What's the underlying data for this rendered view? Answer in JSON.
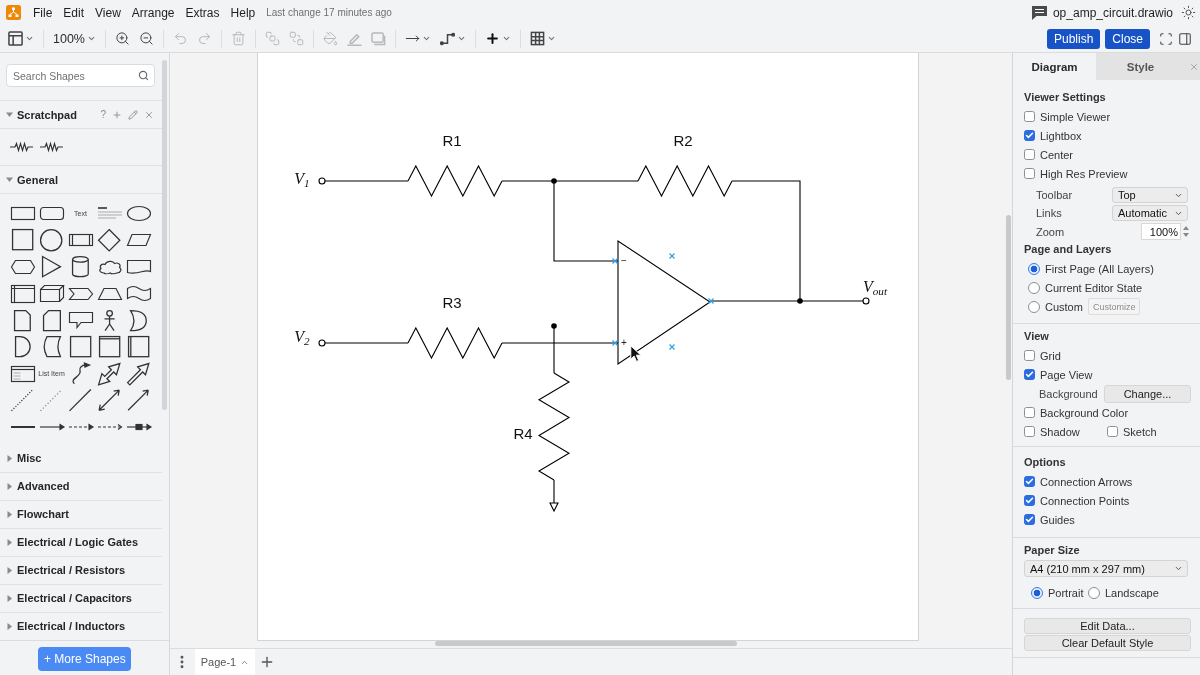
{
  "menubar": {
    "menus": [
      "File",
      "Edit",
      "View",
      "Arrange",
      "Extras",
      "Help"
    ],
    "last_change": "Last change 17 minutes ago",
    "file_name": "op_amp_circuit.drawio"
  },
  "toolbar": {
    "tool_groups": [
      [
        {
          "kind": "format",
          "disabled": false
        }
      ],
      [
        {
          "kind": "zoom",
          "label": "100%",
          "disabled": false
        }
      ],
      [
        {
          "kind": "zoom-in",
          "disabled": false
        },
        {
          "kind": "zoom-out",
          "disabled": false
        }
      ],
      [
        {
          "kind": "undo",
          "disabled": true
        },
        {
          "kind": "redo",
          "disabled": true
        }
      ],
      [
        {
          "kind": "delete",
          "disabled": true
        }
      ],
      [
        {
          "kind": "to-front",
          "disabled": true
        },
        {
          "kind": "to-back",
          "disabled": true
        }
      ],
      [
        {
          "kind": "fill",
          "disabled": true
        },
        {
          "kind": "line",
          "disabled": true
        },
        {
          "kind": "shadow",
          "disabled": true
        }
      ],
      [
        {
          "kind": "connection",
          "disabled": false
        },
        {
          "kind": "waypoints",
          "disabled": false
        }
      ],
      [
        {
          "kind": "insert",
          "disabled": false
        }
      ],
      [
        {
          "kind": "table",
          "disabled": false
        }
      ]
    ],
    "buttons": [
      "Publish",
      "Close"
    ]
  },
  "sidebar": {
    "search": {
      "placeholder": "Search Shapes"
    },
    "scratchpad": {
      "title": "Scratchpad",
      "expanded": true,
      "help": "?"
    },
    "general": {
      "title": "General",
      "expanded": true,
      "shape_captions": [
        "Text",
        "List Item"
      ]
    },
    "libraries": [
      {
        "title": "Misc",
        "expanded": false
      },
      {
        "title": "Advanced",
        "expanded": false
      },
      {
        "title": "Flowchart",
        "expanded": false
      },
      {
        "title": "Electrical / Logic Gates",
        "expanded": false
      },
      {
        "title": "Electrical / Resistors",
        "expanded": false
      },
      {
        "title": "Electrical / Capacitors",
        "expanded": false
      },
      {
        "title": "Electrical / Inductors",
        "expanded": false
      }
    ],
    "more_button": "+ More Shapes"
  },
  "diagram": {
    "components": [
      {
        "kind": "resistor",
        "label": "R1"
      },
      {
        "kind": "resistor",
        "label": "R2"
      },
      {
        "kind": "terminal",
        "label": "V$_{1}$"
      },
      {
        "kind": "opamp",
        "hovered": true,
        "inverting_sign": "−",
        "noninverting_sign": "+"
      },
      {
        "kind": "terminal",
        "label": "V$_{out}$"
      },
      {
        "kind": "resistor",
        "label": "R3"
      },
      {
        "kind": "terminal",
        "label": "V$_{2}$"
      },
      {
        "kind": "resistor",
        "label": "R4"
      },
      {
        "kind": "ground"
      }
    ]
  },
  "pages": [
    {
      "label": "Page-1",
      "selected": true
    }
  ],
  "format_panel": {
    "tabs": [
      {
        "label": "Diagram",
        "selected": true
      },
      {
        "label": "Style",
        "selected": false
      }
    ],
    "viewer_settings": {
      "title": "Viewer Settings",
      "options": [
        {
          "label": "Simple Viewer",
          "checked": false
        },
        {
          "label": "Lightbox",
          "checked": true
        },
        {
          "label": "Center",
          "checked": false
        },
        {
          "label": "High Res Preview",
          "checked": false
        }
      ],
      "fields": [
        {
          "kind": "select",
          "label": "Toolbar",
          "value": "Top"
        },
        {
          "kind": "select",
          "label": "Links",
          "value": "Automatic"
        },
        {
          "kind": "spinner",
          "label": "Zoom",
          "value": "100%"
        }
      ]
    },
    "page_and_layers": {
      "title": "Page and Layers",
      "choices": [
        {
          "label": "First Page (All Layers)",
          "selected": true
        },
        {
          "label": "Current Editor State",
          "selected": false
        },
        {
          "label": "Custom",
          "selected": false
        }
      ],
      "customize_button": {
        "label": "Customize",
        "disabled": true
      }
    },
    "view": {
      "title": "View",
      "items": [
        {
          "kind": "checkbox",
          "label": "Grid",
          "checked": false
        },
        {
          "kind": "checkbox",
          "label": "Page View",
          "checked": true
        },
        {
          "kind": "button",
          "label": "Background",
          "button": "Change..."
        },
        {
          "kind": "checkbox",
          "label": "Background Color",
          "checked": false
        },
        {
          "kind": "pair",
          "options": [
            {
              "label": "Shadow",
              "checked": false
            },
            {
              "label": "Sketch",
              "checked": false
            }
          ]
        }
      ]
    },
    "options": {
      "title": "Options",
      "options": [
        {
          "label": "Connection Arrows",
          "checked": true
        },
        {
          "label": "Connection Points",
          "checked": true
        },
        {
          "label": "Guides",
          "checked": true
        }
      ]
    },
    "paper_size": {
      "title": "Paper Size",
      "value": "A4 (210 mm x 297 mm)",
      "orientations": [
        {
          "label": "Portrait",
          "selected": true
        },
        {
          "label": "Landscape",
          "selected": false
        }
      ]
    },
    "buttons": [
      "Edit Data...",
      "Clear Default Style"
    ]
  }
}
